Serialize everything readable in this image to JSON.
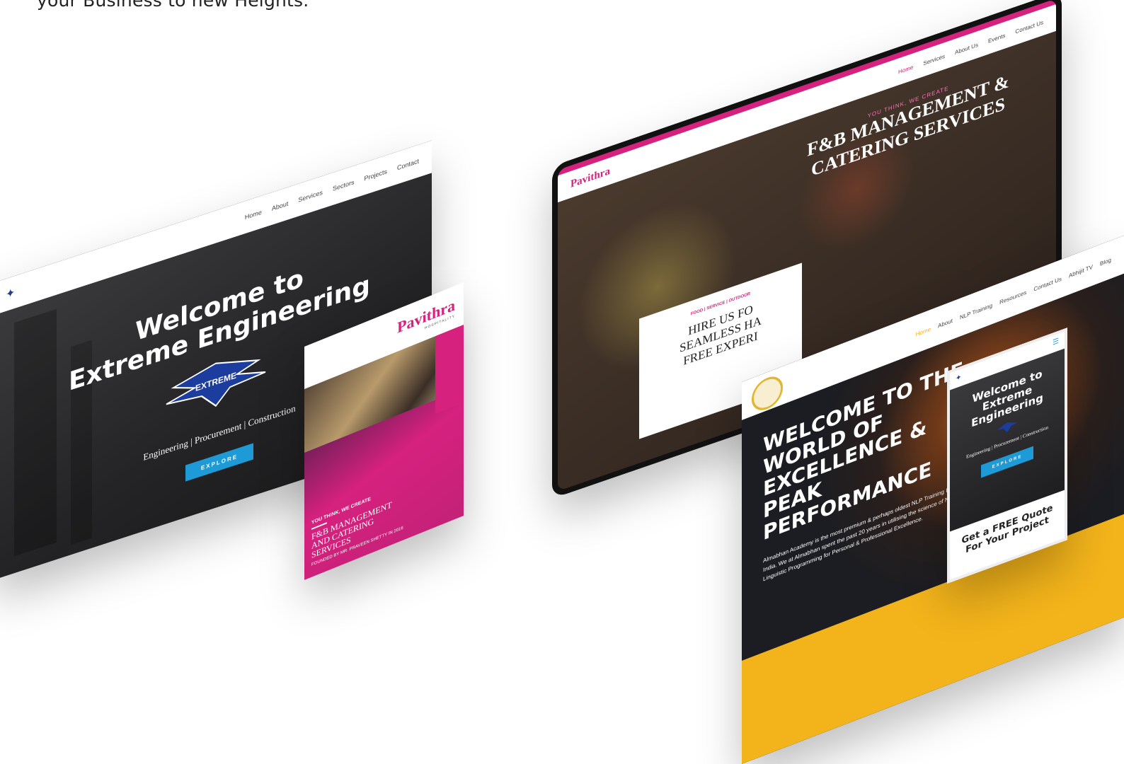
{
  "tagline": "your Business to new Heights.",
  "extreme_desktop": {
    "nav": [
      "Home",
      "About",
      "Services",
      "Sectors",
      "Projects",
      "Contact"
    ],
    "title_line1": "Welcome to",
    "title_line2": "Extreme Engineering",
    "logo_text": "EXTREME",
    "subtitle": "Engineering | Procurement | Construction",
    "button": "EXPLORE"
  },
  "pavithra_card": {
    "logo": "Pavithra",
    "logo_sub": "HOSPITALITY",
    "kicker": "YOU THINK, WE CREATE",
    "title": "F&B MANAGEMENT AND CATERING SERVICES",
    "founded": "FOUNDED BY MR. PRAVEEN SHETTY IN 2016"
  },
  "tablet": {
    "logo": "Pavithra",
    "nav": [
      "Home",
      "Services",
      "About Us",
      "Events",
      "Contact Us"
    ],
    "kicker": "YOU THINK, WE CREATE",
    "title_line1": "F&B MANAGEMENT &",
    "title_line2": "CATERING SERVICES",
    "card_kicker": "FOOD | SERVICE | OUTDOOR",
    "card_lines": [
      "HIRE US FO",
      "SEAMLESS HA",
      "FREE EXPERI"
    ]
  },
  "academy": {
    "nav": [
      "Home",
      "About",
      "NLP Training",
      "Resources",
      "Contact Us",
      "Abhijit TV",
      "Blog"
    ],
    "title_lines": [
      "WELCOME TO THE",
      "WORLD OF",
      "EXCELLENCE &",
      "PEAK",
      "PERFORMANCE"
    ],
    "body": "Almabhan Academy is the most premium & perhaps oldest NLP Training Institutes in India. We at Almabhan spent the past 20 years in utilising the science of Neuro Linguistic Programming for Personal & Professional Excellence."
  },
  "phone": {
    "title_line1": "Welcome to",
    "title_line2": "Extreme",
    "title_line3": "Engineering",
    "subtitle": "Engineering | Procurement | Construction",
    "button": "EXPLORE",
    "cta_line1": "Get a FREE Quote",
    "cta_line2": "For Your Project"
  },
  "colors": {
    "extreme_blue": "#1e9bd7",
    "pavithra_magenta": "#d6217f",
    "academy_gold": "#f2b31b",
    "dark_hero": "#2a2a2c"
  }
}
